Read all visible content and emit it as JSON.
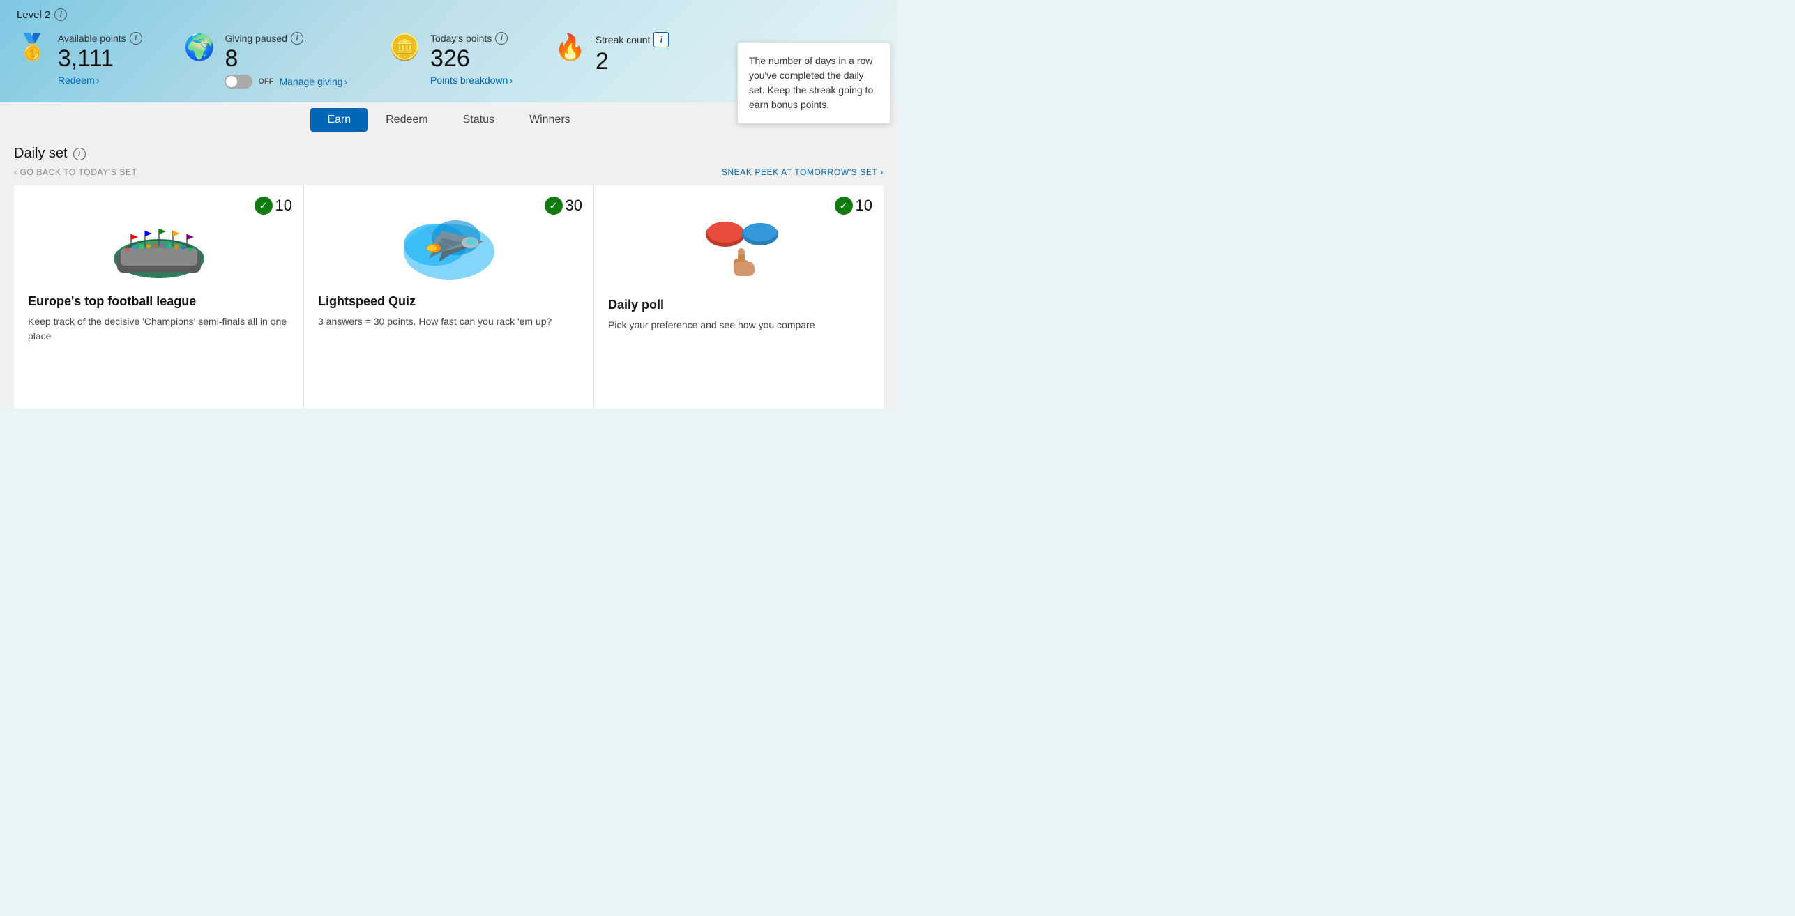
{
  "level": {
    "text": "Level 2",
    "info_label": "i"
  },
  "stats": {
    "available_points": {
      "label": "Available points",
      "value": "3,111",
      "link": "Redeem",
      "chevron": "›",
      "icon": "🥇"
    },
    "giving_paused": {
      "label": "Giving paused",
      "value": "8",
      "toggle_off": "OFF",
      "link": "Manage giving",
      "chevron": "›",
      "icon": "🌍"
    },
    "todays_points": {
      "label": "Today's points",
      "value": "326",
      "link": "Points breakdown",
      "chevron": "›",
      "icon": "🪙"
    },
    "streak_count": {
      "label": "Streak count",
      "value": "2",
      "icon": "🔥"
    }
  },
  "streak_tooltip": {
    "text": "The number of days in a row you've completed the daily set. Keep the streak going to earn bonus points."
  },
  "tabs": [
    {
      "label": "Earn",
      "active": true
    },
    {
      "label": "Redeem",
      "active": false
    },
    {
      "label": "Status",
      "active": false
    },
    {
      "label": "Winners",
      "active": false
    }
  ],
  "daily_set": {
    "title": "Daily set",
    "nav_back": "GO BACK TO TODAY'S SET",
    "nav_forward": "SNEAK PEEK AT TOMORROW'S SET",
    "nav_back_chevron": "‹",
    "nav_forward_chevron": "›"
  },
  "cards": [
    {
      "points": "10",
      "completed": true,
      "title": "Europe's top football league",
      "description": "Keep track of the decisive 'Champions' semi-finals all in one place",
      "icon_type": "stadium"
    },
    {
      "points": "30",
      "completed": true,
      "title": "Lightspeed Quiz",
      "description": "3 answers = 30 points. How fast can you rack 'em up?",
      "icon_type": "jet"
    },
    {
      "points": "10",
      "completed": true,
      "title": "Daily poll",
      "description": "Pick your preference and see how you compare",
      "icon_type": "poll"
    }
  ]
}
